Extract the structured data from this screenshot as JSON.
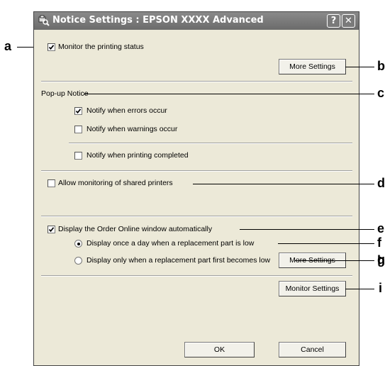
{
  "window": {
    "title": "Notice Settings : EPSON XXXX Advanced",
    "help_btn": "?",
    "close_btn": "✕"
  },
  "monitor": {
    "label": "Monitor the printing status",
    "checked": true,
    "more_settings": "More Settings"
  },
  "popup": {
    "heading": "Pop-up Notice",
    "errors": "Notify when errors occur",
    "warnings": "Notify when warnings occur",
    "completed": "Notify when printing completed"
  },
  "shared": {
    "label": "Allow monitoring of shared printers"
  },
  "order": {
    "label": "Display the Order Online window automatically",
    "once_a_day": "Display once a day when a replacement part is low",
    "only_first": "Display only when a replacement part first becomes low",
    "more_settings": "More Settings"
  },
  "monitor_settings": "Monitor Settings",
  "dialog_buttons": {
    "ok": "OK",
    "cancel": "Cancel"
  },
  "callouts": [
    "a",
    "b",
    "c",
    "d",
    "e",
    "f",
    "g",
    "h",
    "i"
  ]
}
